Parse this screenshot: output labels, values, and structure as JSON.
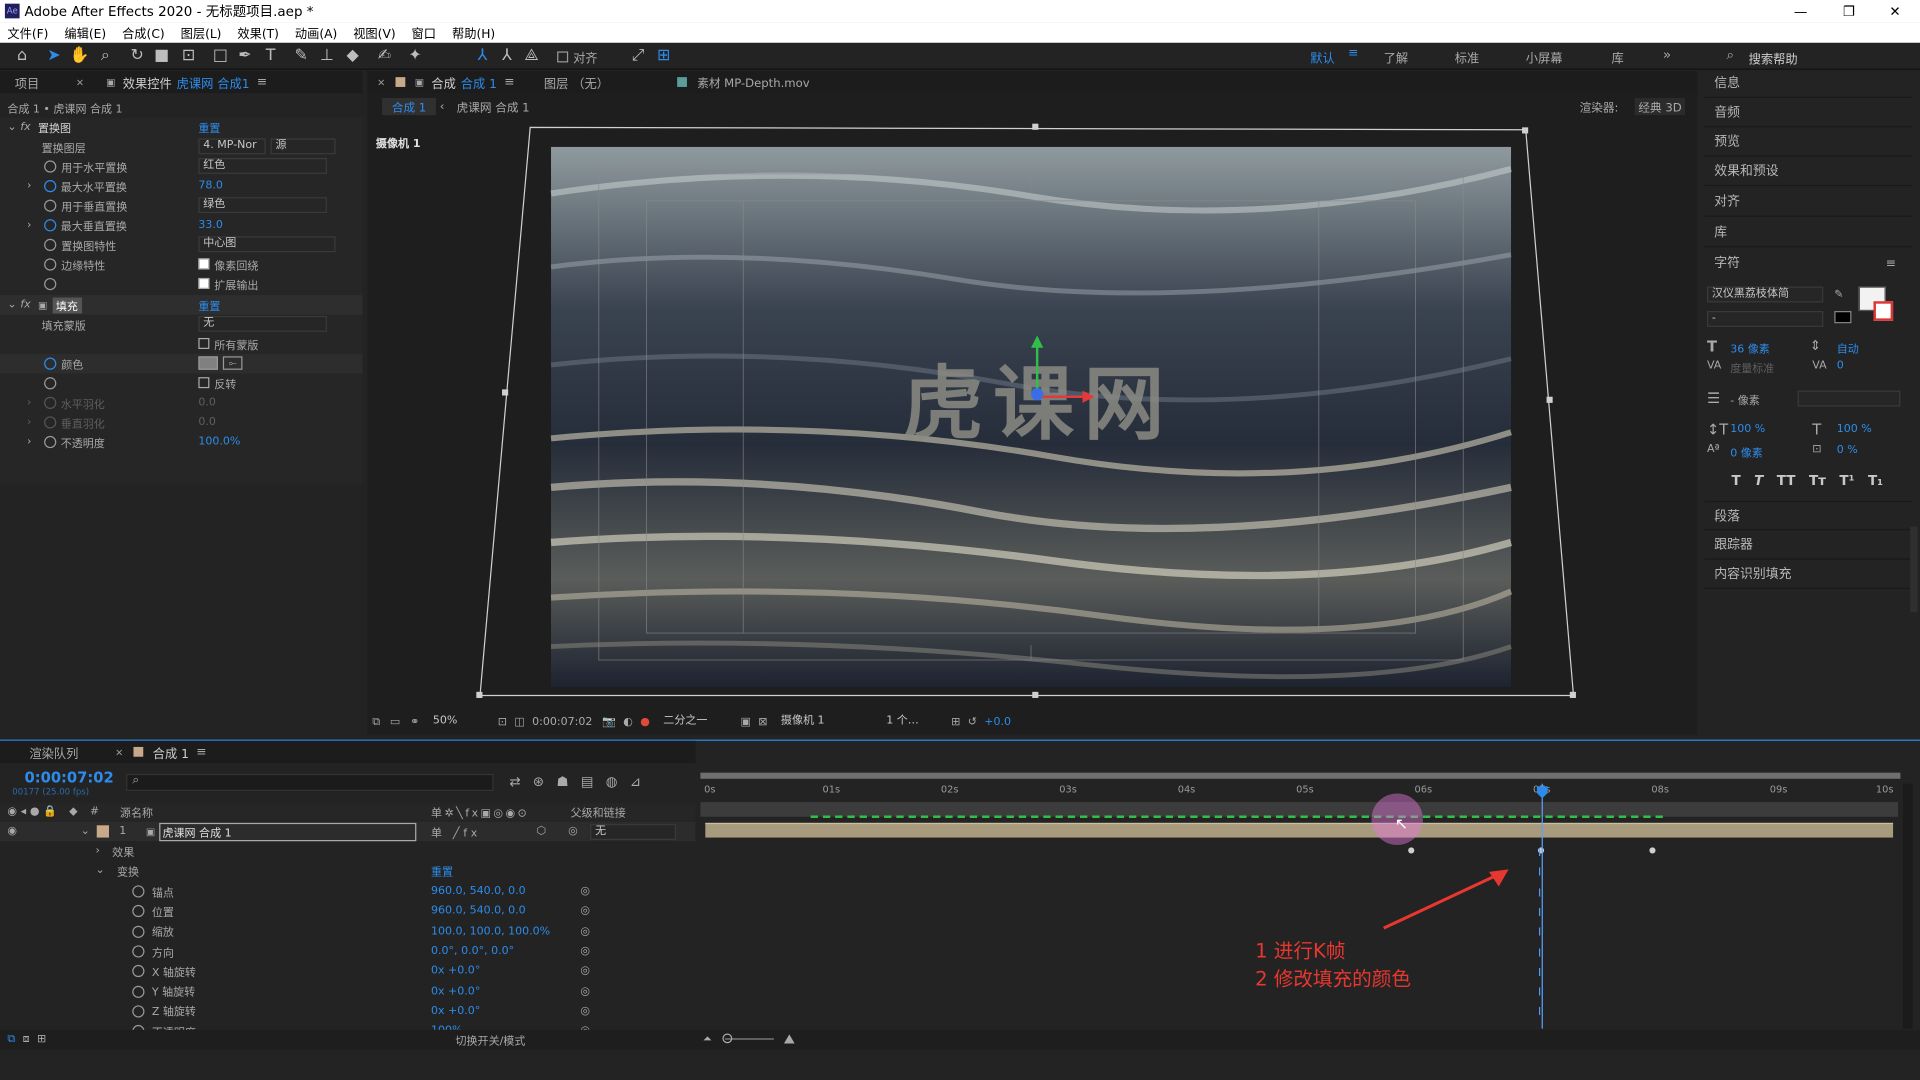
{
  "app": {
    "title": "Adobe After Effects 2020 - 无标题项目.aep *",
    "menu": [
      "文件(F)",
      "编辑(E)",
      "合成(C)",
      "图层(L)",
      "效果(T)",
      "动画(A)",
      "视图(V)",
      "窗口",
      "帮助(H)"
    ]
  },
  "toolbar": {
    "align_label": "对齐",
    "workspaces": [
      "默认",
      "了解",
      "标准",
      "小屏幕",
      "库"
    ],
    "search_help": "搜索帮助"
  },
  "effects_panel": {
    "tab_project": "项目",
    "tab_effects": "效果控件",
    "tab_effects_target": "虎课网 合成1",
    "breadcrumb": "合成 1 • 虎课网 合成 1",
    "displacement": {
      "name": "置换图",
      "reset": "重置",
      "map_layer_label": "置换图层",
      "map_layer_value": "4. MP-Nor",
      "map_layer_source": "源",
      "h_use_label": "用于水平置换",
      "h_use_value": "红色",
      "h_max_label": "最大水平置换",
      "h_max_value": "78.0",
      "v_use_label": "用于垂直置换",
      "v_use_value": "绿色",
      "v_max_label": "最大垂直置换",
      "v_max_value": "33.0",
      "behavior_label": "置换图特性",
      "behavior_value": "中心图",
      "edge_label": "边缘特性",
      "wrap_label": "像素回绕",
      "expand_label": "扩展输出"
    },
    "fill": {
      "name": "填充",
      "reset": "重置",
      "mask_label": "填充蒙版",
      "mask_value": "无",
      "all_masks_label": "所有蒙版",
      "color_label": "颜色",
      "color_value": "#808080",
      "invert_label": "反转",
      "h_feather_label": "水平羽化",
      "h_feather_value": "0.0",
      "v_feather_label": "垂直羽化",
      "v_feather_value": "0.0",
      "opacity_label": "不透明度",
      "opacity_value": "100.0%"
    }
  },
  "viewer": {
    "tab_comp": "合成",
    "tab_comp_name": "合成 1",
    "tab_layer": "图层 （无）",
    "tab_footage": "素材 MP-Depth.mov",
    "flow": [
      "合成 1",
      "虎课网 合成 1"
    ],
    "renderer_label": "渲染器:",
    "renderer_value": "经典 3D",
    "camera_label": "摄像机 1",
    "overlay_text": "虎课网",
    "bottom": {
      "zoom": "50%",
      "time": "0:00:07:02",
      "resolution": "二分之一",
      "camera": "摄像机 1",
      "views": "1 个…",
      "exposure": "+0.0"
    }
  },
  "right_panel": {
    "items_top": [
      "信息",
      "音频",
      "预览",
      "效果和预设",
      "对齐",
      "库"
    ],
    "character_title": "字符",
    "font": "汉仪黑荔枝体简",
    "font_style": "-",
    "size": "36 像素",
    "leading": "自动",
    "kerning": "度量标准",
    "tracking": "0",
    "stroke": "- 像素",
    "v_scale": "100 %",
    "h_scale": "100 %",
    "baseline": "0 像素",
    "tsume": "0 %",
    "styles": [
      "T",
      "T",
      "TT",
      "Tт",
      "T¹",
      "T₁"
    ],
    "items_bottom": [
      "段落",
      "跟踪器",
      "内容识别填充"
    ]
  },
  "timeline": {
    "tab_render": "渲染队列",
    "tab_comp": "合成 1",
    "timecode": "0:00:07:02",
    "frame_info": "00177 (25.00 fps)",
    "col_source": "源名称",
    "col_parent": "父级和链接",
    "layer": {
      "index": "1",
      "name": "虎课网 合成 1",
      "parent": "无"
    },
    "effects_label": "效果",
    "transform_label": "变换",
    "transform_reset": "重置",
    "props": [
      {
        "name": "锚点",
        "value": "960.0, 540.0, 0.0"
      },
      {
        "name": "位置",
        "value": "960.0, 540.0, 0.0"
      },
      {
        "name": "缩放",
        "value": "100.0, 100.0, 100.0%"
      },
      {
        "name": "方向",
        "value": "0.0°, 0.0°, 0.0°"
      },
      {
        "name": "X 轴旋转",
        "value": "0x +0.0°"
      },
      {
        "name": "Y 轴旋转",
        "value": "0x +0.0°"
      },
      {
        "name": "Z 轴旋转",
        "value": "0x +0.0°"
      },
      {
        "name": "不透明度",
        "value": "100%"
      }
    ],
    "ruler": [
      "0s",
      "01s",
      "02s",
      "03s",
      "04s",
      "05s",
      "06s",
      "07s",
      "08s",
      "09s",
      "10s"
    ],
    "toggle_modes": "切换开关/模式",
    "annotation_line1": "1 进行K帧",
    "annotation_line2": "2 修改填充的颜色"
  },
  "colors": {
    "accent": "#2d8ceb",
    "annotation": "#e8372f",
    "layer_bar": "#a89a7d"
  }
}
